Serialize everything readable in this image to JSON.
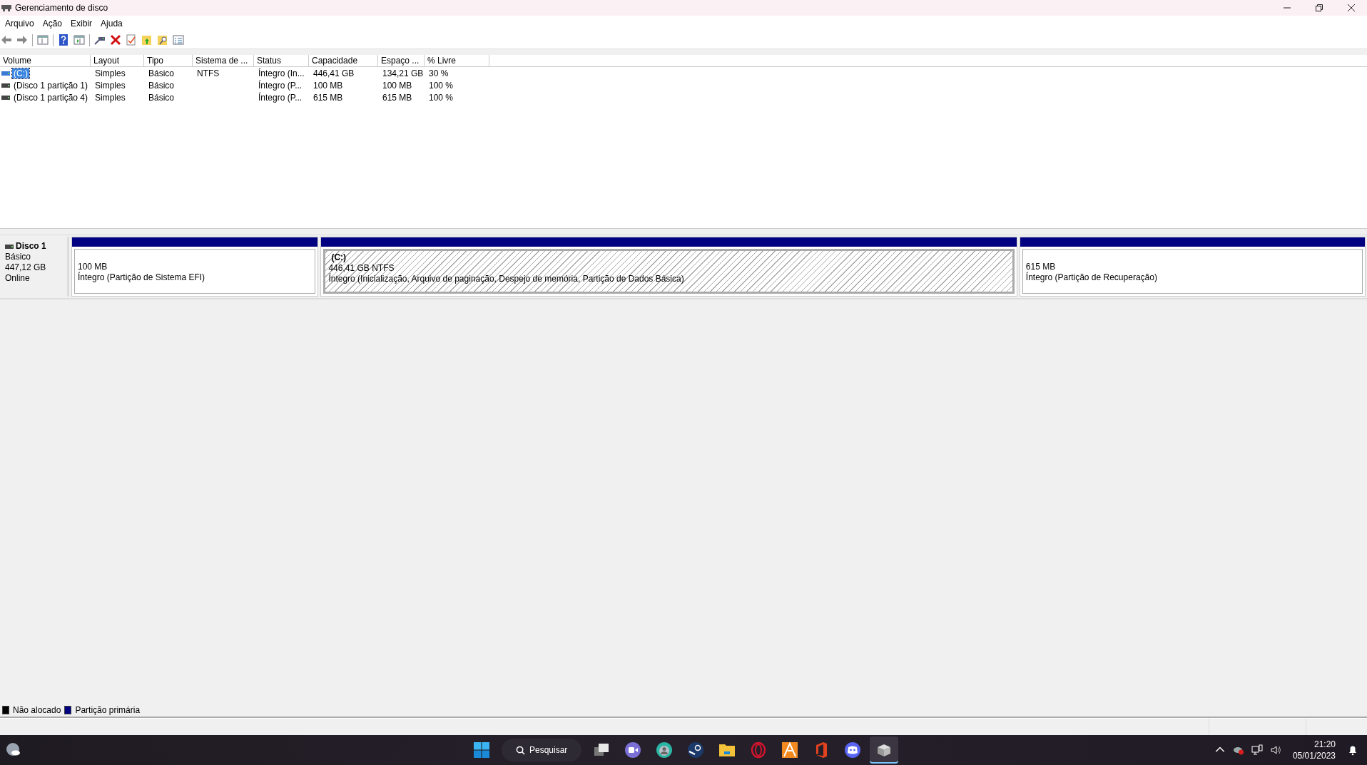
{
  "window": {
    "title": "Gerenciamento de disco"
  },
  "menu": [
    "Arquivo",
    "Ação",
    "Exibir",
    "Ajuda"
  ],
  "volume_table": {
    "columns": [
      "Volume",
      "Layout",
      "Tipo",
      "Sistema de ...",
      "Status",
      "Capacidade",
      "Espaço ...",
      "% Livre"
    ],
    "rows": [
      {
        "selected": true,
        "cells": [
          "(C:)",
          "Simples",
          "Básico",
          "NTFS",
          "Íntegro (In...",
          "446,41 GB",
          "134,21 GB",
          "30 %"
        ]
      },
      {
        "selected": false,
        "cells": [
          "(Disco 1 partição 1)",
          "Simples",
          "Básico",
          "",
          "Íntegro (P...",
          "100 MB",
          "100 MB",
          "100 %"
        ]
      },
      {
        "selected": false,
        "cells": [
          "(Disco 1 partição 4)",
          "Simples",
          "Básico",
          "",
          "Íntegro (P...",
          "615 MB",
          "615 MB",
          "100 %"
        ]
      }
    ]
  },
  "disks": [
    {
      "name": "Disco 1",
      "type": "Básico",
      "size": "447,12 GB",
      "status": "Online",
      "partitions": [
        {
          "selected": false,
          "size": "100 MB",
          "status": "Íntegro (Partição de Sistema EFI)"
        },
        {
          "selected": true,
          "name": "(C:)",
          "size": "446,41 GB NTFS",
          "status": "Íntegro (Inicialização, Arquivo de paginação, Despejo de memória, Partição de Dados Básica)"
        },
        {
          "selected": false,
          "size": "615 MB",
          "status": "Íntegro (Partição de Recuperação)"
        }
      ]
    }
  ],
  "legend": [
    {
      "label": "Não alocado",
      "color": "#000000"
    },
    {
      "label": "Partição primária",
      "color": "#000080"
    }
  ],
  "taskbar": {
    "search": "Pesquisar",
    "apps": [
      {
        "kind": "taskview",
        "active": false
      },
      {
        "kind": "chat",
        "active": false
      },
      {
        "kind": "browser",
        "active": false
      },
      {
        "kind": "steam",
        "active": false
      },
      {
        "kind": "folder",
        "active": false
      },
      {
        "kind": "opera",
        "active": false
      },
      {
        "kind": "orange",
        "active": false
      },
      {
        "kind": "office",
        "active": false
      },
      {
        "kind": "discord",
        "active": false
      },
      {
        "kind": "diskmgmt",
        "active": true
      }
    ],
    "time": "21:20",
    "date": "05/01/2023"
  }
}
